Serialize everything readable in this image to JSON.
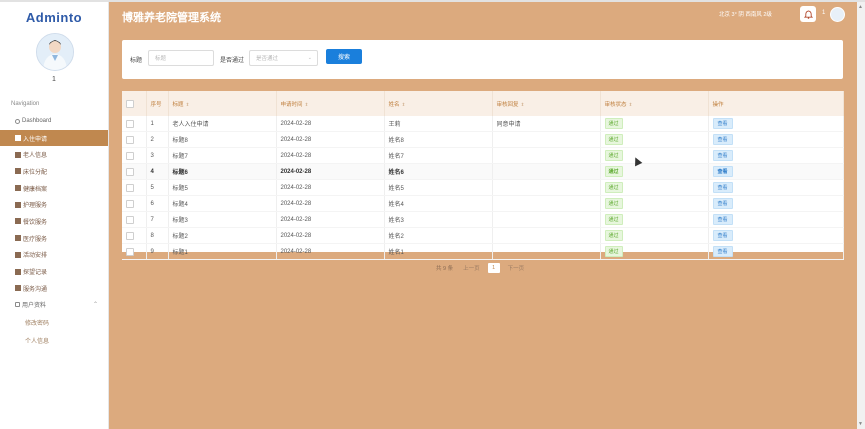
{
  "brand": "Adminto",
  "user": {
    "name": "1"
  },
  "nav": {
    "label": "Navigation",
    "items": [
      {
        "label": "Dashboard",
        "icon": "home-icon"
      },
      {
        "label": "入住申请",
        "icon": "house-icon"
      },
      {
        "label": "老人信息",
        "icon": "grid-icon"
      },
      {
        "label": "床位分配",
        "icon": "grid-icon"
      },
      {
        "label": "健康档案",
        "icon": "grid-icon"
      },
      {
        "label": "护理服务",
        "icon": "grid-icon"
      },
      {
        "label": "餐饮服务",
        "icon": "grid-icon"
      },
      {
        "label": "医疗服务",
        "icon": "grid-icon"
      },
      {
        "label": "活动安排",
        "icon": "list-icon"
      },
      {
        "label": "探望记录",
        "icon": "user-icon"
      },
      {
        "label": "服务沟通",
        "icon": "grid-icon"
      }
    ],
    "user_menu": {
      "label": "用户资料",
      "icon": "user-card-icon"
    },
    "sub_items": [
      {
        "label": "修改密码"
      },
      {
        "label": "个人信息"
      }
    ],
    "active_index": 1
  },
  "header": {
    "title": "博雅养老院管理系统",
    "weather": "北京 3° 阴 西南风 2级",
    "user_num": "1"
  },
  "search": {
    "title_label": "标题",
    "title_placeholder": "标题",
    "pass_label": "是否通过",
    "pass_placeholder": "是否通过",
    "button_label": "搜索"
  },
  "table": {
    "headers": [
      "",
      "序号",
      "标题",
      "申请时间",
      "姓名",
      "审核回复",
      "审核状态",
      "操作"
    ],
    "rows": [
      {
        "no": "1",
        "title": "老人入住申请",
        "date": "2024-02-28",
        "name": "王莉",
        "reply": "同意申请",
        "status": "通过",
        "action": "查看",
        "bold": false
      },
      {
        "no": "2",
        "title": "标题8",
        "date": "2024-02-28",
        "name": "姓名8",
        "reply": "",
        "status": "通过",
        "action": "查看",
        "bold": false
      },
      {
        "no": "3",
        "title": "标题7",
        "date": "2024-02-28",
        "name": "姓名7",
        "reply": "",
        "status": "通过",
        "action": "查看",
        "bold": false
      },
      {
        "no": "4",
        "title": "标题6",
        "date": "2024-02-28",
        "name": "姓名6",
        "reply": "",
        "status": "通过",
        "action": "查看",
        "bold": true
      },
      {
        "no": "5",
        "title": "标题5",
        "date": "2024-02-28",
        "name": "姓名5",
        "reply": "",
        "status": "通过",
        "action": "查看",
        "bold": false
      },
      {
        "no": "6",
        "title": "标题4",
        "date": "2024-02-28",
        "name": "姓名4",
        "reply": "",
        "status": "通过",
        "action": "查看",
        "bold": false
      },
      {
        "no": "7",
        "title": "标题3",
        "date": "2024-02-28",
        "name": "姓名3",
        "reply": "",
        "status": "通过",
        "action": "查看",
        "bold": false
      },
      {
        "no": "8",
        "title": "标题2",
        "date": "2024-02-28",
        "name": "姓名2",
        "reply": "",
        "status": "通过",
        "action": "查看",
        "bold": false
      },
      {
        "no": "9",
        "title": "标题1",
        "date": "2024-02-28",
        "name": "姓名1",
        "reply": "",
        "status": "通过",
        "action": "查看",
        "bold": false
      }
    ]
  },
  "pagination": {
    "total": "共 9 条",
    "prev": "上一页",
    "current": "1",
    "next": "下一页"
  },
  "colors": {
    "accent": "#c0884f",
    "background": "#dcaa7e",
    "primary_button": "#1a7fdc",
    "brand": "#2e5aa8"
  }
}
